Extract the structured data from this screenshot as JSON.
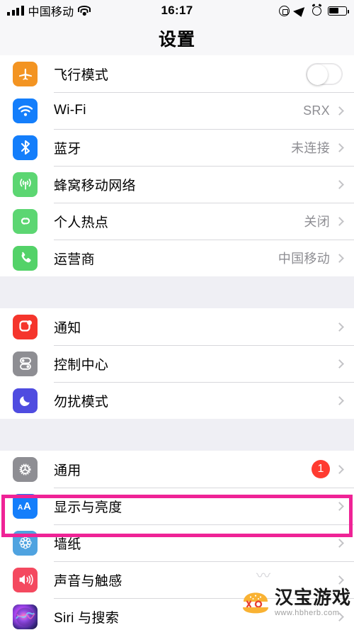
{
  "statusbar": {
    "carrier": "中国移动",
    "time": "16:17",
    "signal_icon": "signal-bars-icon",
    "wifi_icon": "wifi-icon",
    "rotation_lock_icon": "rotation-lock-icon",
    "location_icon": "location-arrow-icon",
    "alarm_icon": "alarm-clock-icon",
    "battery_icon": "battery-icon",
    "battery_level": "58"
  },
  "navbar": {
    "title": "设置"
  },
  "groups": [
    {
      "rows": [
        {
          "label": "飞行模式",
          "icon": "airplane-icon",
          "icon_class": "ic-airplane",
          "accessory": "toggle",
          "toggle_on": false
        },
        {
          "label": "Wi-Fi",
          "icon": "wifi-icon",
          "icon_class": "ic-wifi",
          "accessory": "chevron",
          "value": "SRX"
        },
        {
          "label": "蓝牙",
          "icon": "bluetooth-icon",
          "icon_class": "ic-bt",
          "accessory": "chevron",
          "value": "未连接"
        },
        {
          "label": "蜂窝移动网络",
          "icon": "cellular-icon",
          "icon_class": "ic-cell",
          "accessory": "chevron",
          "value": ""
        },
        {
          "label": "个人热点",
          "icon": "hotspot-icon",
          "icon_class": "ic-hotspot",
          "accessory": "chevron",
          "value": "关闭"
        },
        {
          "label": "运营商",
          "icon": "phone-icon",
          "icon_class": "ic-phone",
          "accessory": "chevron",
          "value": "中国移动"
        }
      ]
    },
    {
      "rows": [
        {
          "label": "通知",
          "icon": "notifications-icon",
          "icon_class": "ic-notify",
          "accessory": "chevron",
          "value": ""
        },
        {
          "label": "控制中心",
          "icon": "control-center-icon",
          "icon_class": "ic-cc",
          "accessory": "chevron",
          "value": ""
        },
        {
          "label": "勿扰模式",
          "icon": "do-not-disturb-moon-icon",
          "icon_class": "ic-dnd",
          "accessory": "chevron",
          "value": ""
        }
      ]
    },
    {
      "rows": [
        {
          "label": "通用",
          "icon": "gear-icon",
          "icon_class": "ic-general",
          "accessory": "badge-chevron",
          "badge": "1"
        },
        {
          "label": "显示与亮度",
          "icon": "display-brightness-aa-icon",
          "icon_class": "ic-display",
          "accessory": "chevron",
          "value": "",
          "highlighted": true
        },
        {
          "label": "墙纸",
          "icon": "wallpaper-flower-icon",
          "icon_class": "ic-wallpaper",
          "accessory": "chevron",
          "value": ""
        },
        {
          "label": "声音与触感",
          "icon": "sounds-speaker-icon",
          "icon_class": "ic-sound",
          "accessory": "chevron",
          "value": ""
        },
        {
          "label": "Siri 与搜索",
          "icon": "siri-icon",
          "icon_class": "ic-siri",
          "accessory": "chevron",
          "value": ""
        }
      ]
    }
  ],
  "highlight": {
    "color": "#ef2396",
    "target_label": "显示与亮度"
  },
  "watermark": {
    "title": "汉宝游戏",
    "url": "www.hbherb.com",
    "logo_icon": "burger-logo-icon"
  }
}
